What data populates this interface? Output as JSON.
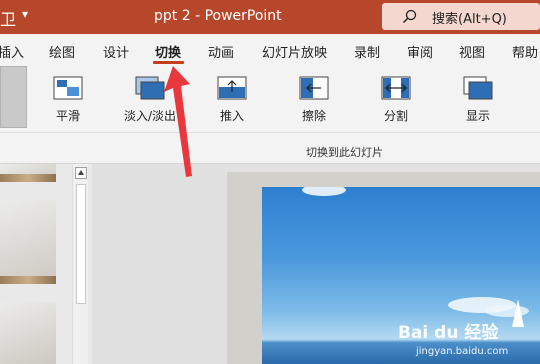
{
  "titlebar": {
    "left_glyph": "卫",
    "qa_glyph": "▾",
    "title": "ppt 2  -  PowerPoint",
    "search_placeholder": "搜索(Alt+Q)"
  },
  "ribbon_tabs": [
    {
      "label": "插入"
    },
    {
      "label": "绘图"
    },
    {
      "label": "设计"
    },
    {
      "label": "切换",
      "active": true
    },
    {
      "label": "动画"
    },
    {
      "label": "幻灯片放映"
    },
    {
      "label": "录制"
    },
    {
      "label": "审阅"
    },
    {
      "label": "视图"
    },
    {
      "label": "帮助"
    }
  ],
  "effects": [
    {
      "label": "平滑",
      "icon": "morph-icon"
    },
    {
      "label": "淡入/淡出",
      "icon": "fade-icon"
    },
    {
      "label": "推入",
      "icon": "push-icon"
    },
    {
      "label": "擦除",
      "icon": "wipe-icon"
    },
    {
      "label": "分割",
      "icon": "split-icon"
    },
    {
      "label": "显示",
      "icon": "reveal-icon"
    }
  ],
  "group_label": "切换到此幻灯片",
  "watermark": {
    "logo": "Bai du 经验",
    "url": "jingyan.baidu.com"
  },
  "colors": {
    "titlebar": "#b7472a",
    "accent": "#c43e1c",
    "annotation_arrow": "#e8383d"
  }
}
